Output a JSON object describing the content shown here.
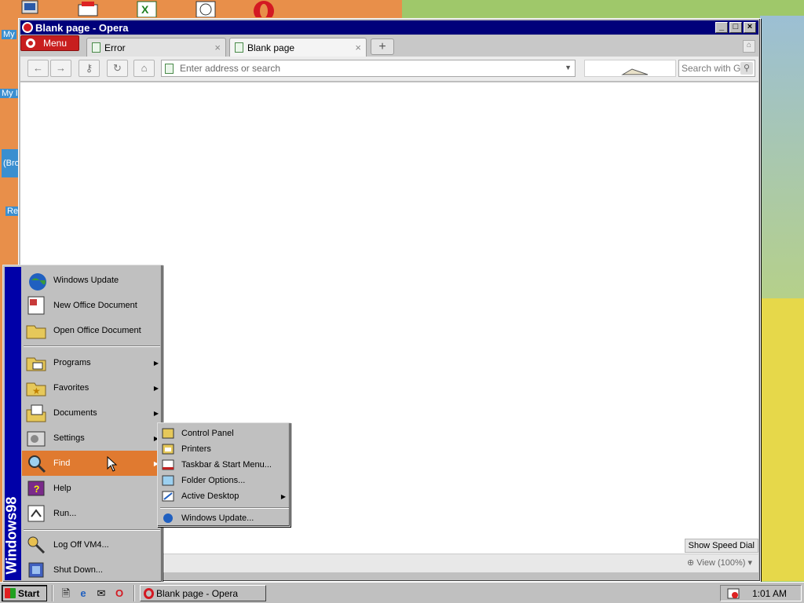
{
  "desktop": {
    "labels": [
      "My",
      "My I",
      "(Bro",
      "Re"
    ]
  },
  "window": {
    "title": "Blank page - Opera",
    "menu_label": "Menu",
    "tabs": [
      {
        "label": "Error",
        "close": "×"
      },
      {
        "label": "Blank page",
        "close": "×"
      }
    ],
    "new_tab_symbol": "+",
    "address_placeholder": "Enter address or search",
    "search_placeholder": "Search with Go",
    "show_speed_dial": "Show Speed Dial",
    "view_zoom": "View (100%)"
  },
  "start_menu": {
    "banner": "Windows98",
    "top_items": [
      {
        "label": "Windows Update"
      },
      {
        "label": "New Office Document"
      },
      {
        "label": "Open Office Document"
      }
    ],
    "items": [
      {
        "label": "Programs",
        "has_submenu": true
      },
      {
        "label": "Favorites",
        "has_submenu": true
      },
      {
        "label": "Documents",
        "has_submenu": true
      },
      {
        "label": "Settings",
        "has_submenu": true
      },
      {
        "label": "Find",
        "has_submenu": true
      },
      {
        "label": "Help"
      },
      {
        "label": "Run..."
      }
    ],
    "bottom_items": [
      {
        "label": "Log Off VM4..."
      },
      {
        "label": "Shut Down..."
      }
    ]
  },
  "settings_submenu": {
    "items": [
      {
        "label": "Control Panel"
      },
      {
        "label": "Printers"
      },
      {
        "label": "Taskbar & Start Menu..."
      },
      {
        "label": "Folder Options..."
      },
      {
        "label": "Active Desktop",
        "has_submenu": true
      }
    ],
    "bottom_item": {
      "label": "Windows Update..."
    }
  },
  "taskbar": {
    "start_label": "Start",
    "task_label": "Blank page - Opera",
    "clock": "1:01 AM"
  },
  "colors": {
    "title_bar": "#00007a",
    "start_banner": "#0000a8",
    "highlight": "#e07a30",
    "opera_red": "#d31922"
  }
}
